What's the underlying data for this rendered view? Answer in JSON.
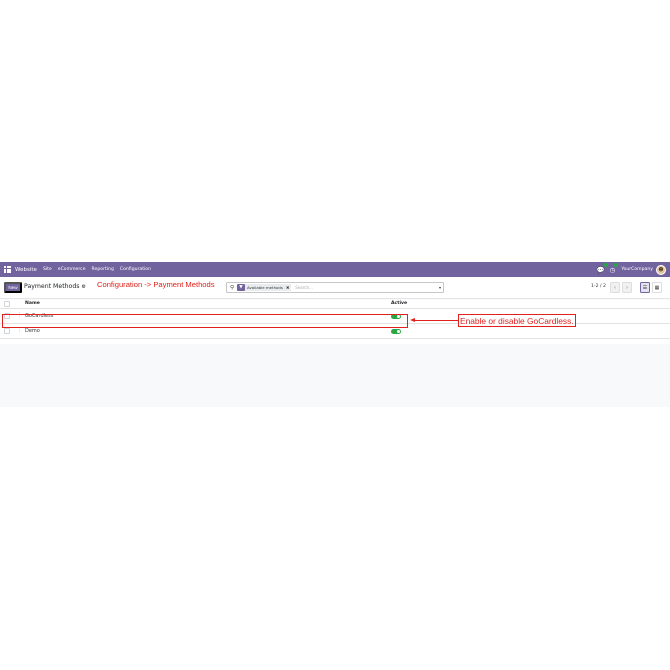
{
  "navbar": {
    "app_name": "Website",
    "menu": [
      "Site",
      "eCommerce",
      "Reporting",
      "Configuration"
    ],
    "company": "YourCompany",
    "chat_icon": "chat-icon",
    "activity_icon": "clock-icon"
  },
  "control": {
    "new_label": "New",
    "breadcrumb": "Payment Methods",
    "search": {
      "facet": "Available methods",
      "placeholder": "Search..."
    },
    "pager": "1-2 / 2"
  },
  "table": {
    "headers": {
      "name": "Name",
      "active": "Active"
    },
    "rows": [
      {
        "name": "GoCardless",
        "active": true
      },
      {
        "name": "Demo",
        "active": true
      }
    ]
  },
  "annotations": {
    "top": "Configuration -> Payment Methods",
    "callout": "Enable or disable GoCardless."
  },
  "colors": {
    "brand": "#71639e",
    "toggle_on": "#28a745",
    "annotation": "#e0211d"
  }
}
